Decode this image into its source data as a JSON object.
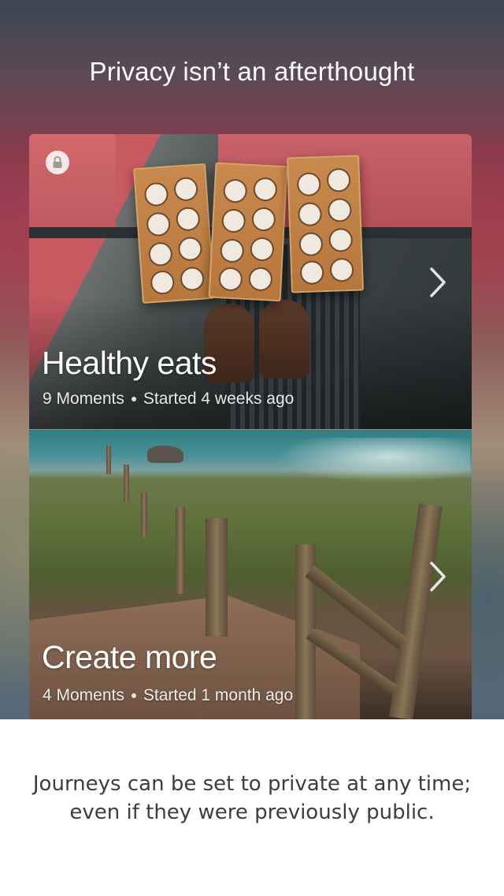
{
  "header": {
    "title": "Privacy isn’t an afterthought"
  },
  "journeys": [
    {
      "title": "Healthy eats",
      "moments": "9 Moments",
      "started": "Started 4 weeks ago",
      "privacy_icon": "lock-icon",
      "nav_icon": "chevron-right-icon"
    },
    {
      "title": "Create more",
      "moments": "4 Moments",
      "started": "Started 1 month ago",
      "nav_icon": "chevron-right-icon"
    }
  ],
  "caption": {
    "line1": "Journeys can be set to private at any time;",
    "line2": "even if they were previously public."
  }
}
